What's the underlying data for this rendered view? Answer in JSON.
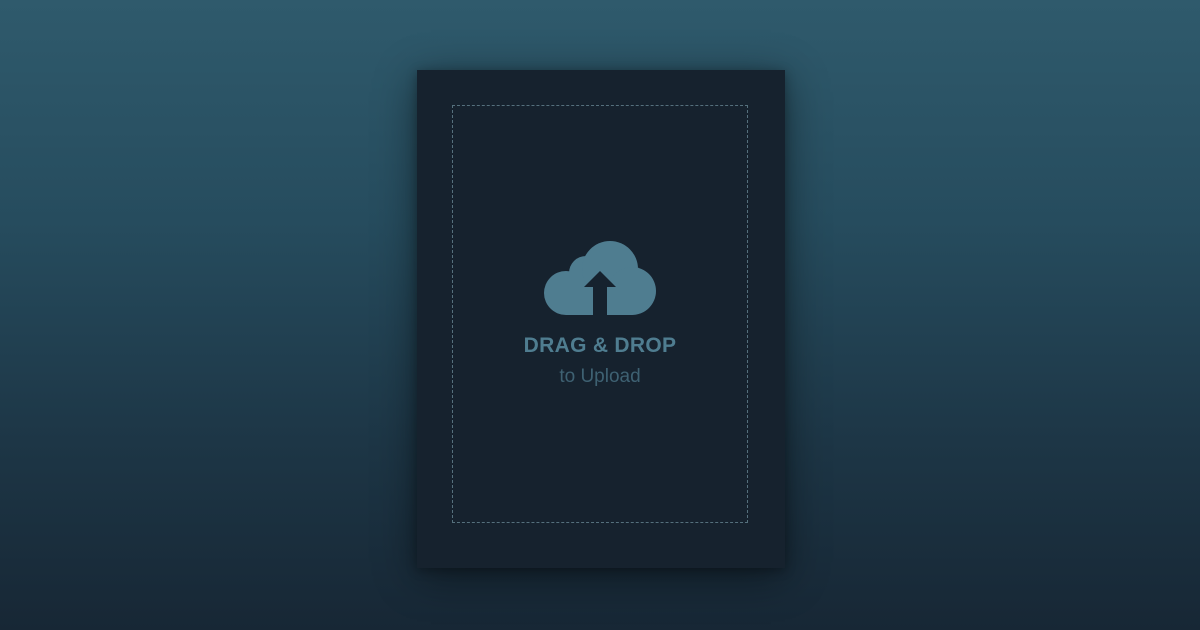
{
  "upload": {
    "title": "DRAG & DROP",
    "subtitle": "to Upload",
    "icon": "cloud-upload-icon"
  },
  "colors": {
    "background_top": "#2f5a6c",
    "background_bottom": "#172735",
    "card": "#16222e",
    "accent": "#4f7d90",
    "subtitle": "#3e6172",
    "dashed_border": "#55707d"
  }
}
